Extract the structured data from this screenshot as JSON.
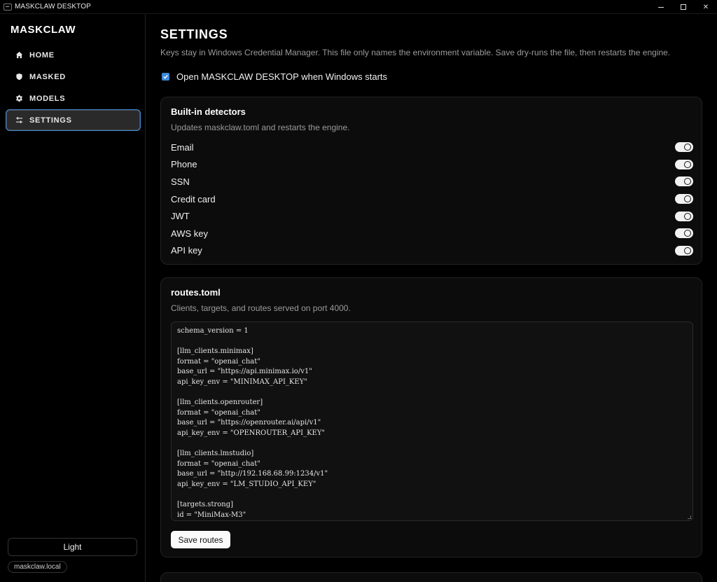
{
  "window": {
    "title": "MASKCLAW DESKTOP"
  },
  "sidebar": {
    "brand": "MASKCLAW",
    "items": [
      {
        "label": "HOME",
        "icon": "home-icon",
        "active": false
      },
      {
        "label": "MASKED",
        "icon": "shield-icon",
        "active": false
      },
      {
        "label": "MODELS",
        "icon": "gear-icon",
        "active": false
      },
      {
        "label": "SETTINGS",
        "icon": "sliders-icon",
        "active": true
      }
    ],
    "theme_label": "Light",
    "host": "maskclaw.local"
  },
  "settings": {
    "title": "SETTINGS",
    "description": "Keys stay in Windows Credential Manager. This file only names the environment variable. Save dry-runs the file, then restarts the engine.",
    "startup_label": "Open MASKCLAW DESKTOP when Windows starts",
    "startup_checked": true
  },
  "detectors": {
    "title": "Built-in detectors",
    "description": "Updates maskclaw.toml and restarts the engine.",
    "items": [
      {
        "label": "Email",
        "enabled": true
      },
      {
        "label": "Phone",
        "enabled": true
      },
      {
        "label": "SSN",
        "enabled": true
      },
      {
        "label": "Credit card",
        "enabled": true
      },
      {
        "label": "JWT",
        "enabled": true
      },
      {
        "label": "AWS key",
        "enabled": true
      },
      {
        "label": "API key",
        "enabled": true
      }
    ]
  },
  "routes": {
    "title": "routes.toml",
    "description": "Clients, targets, and routes served on port 4000.",
    "lines": [
      "schema_version = 1",
      "",
      "[llm_clients.minimax]",
      "format = \"openai_chat\"",
      "base_url = \"https://api.minimax.io/v1\"",
      "api_key_env = \"MINIMAX_API_KEY\"",
      "",
      "[llm_clients.openrouter]",
      "format = \"openai_chat\"",
      "base_url = \"https://openrouter.ai/api/v1\"",
      "api_key_env = \"OPENROUTER_API_KEY\"",
      "",
      "[llm_clients.lmstudio]",
      "format = \"openai_chat\"",
      "base_url = \"http://192.168.68.99:1234/v1\"",
      "api_key_env = \"LM_STUDIO_API_KEY\"",
      "",
      "[targets.strong]",
      "id = \"MiniMax-M3\""
    ],
    "save_label": "Save routes"
  },
  "colors": {
    "accent": "#3d8ad8",
    "background": "#000000",
    "card": "#0c0c0c"
  }
}
